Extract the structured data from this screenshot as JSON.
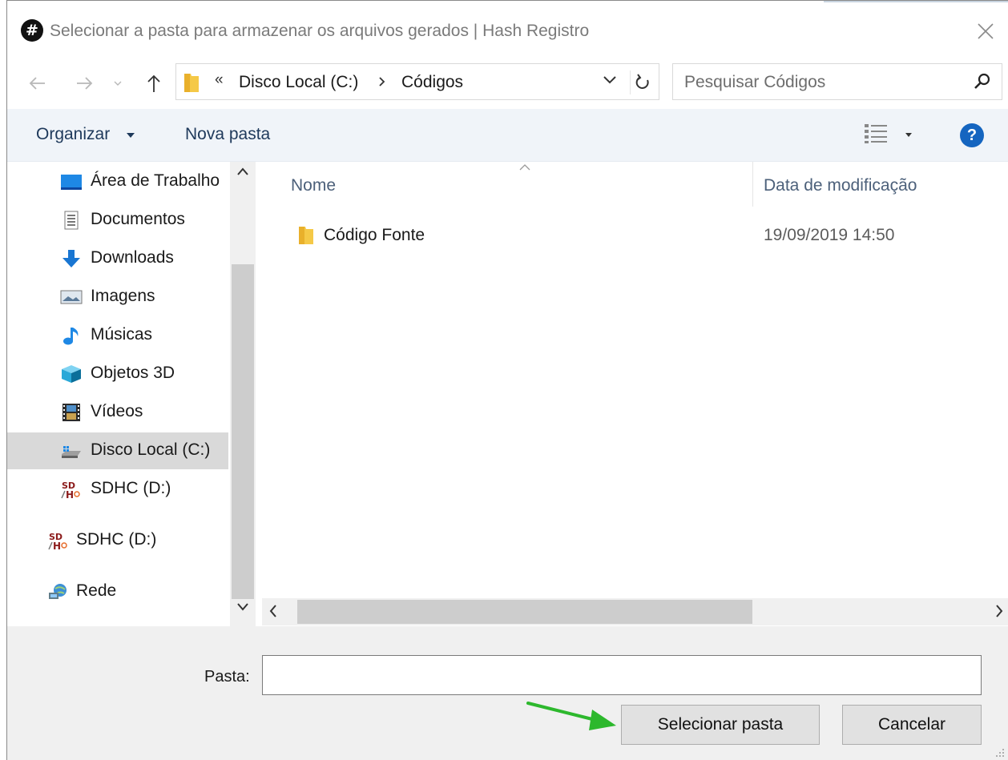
{
  "window": {
    "title": "Selecionar a pasta para armazenar os arquivos gerados | Hash Registro",
    "app_icon_glyph": "#"
  },
  "nav": {
    "address_prefix": "«",
    "breadcrumb": [
      "Disco Local (C:)",
      "Códigos"
    ],
    "search_placeholder": "Pesquisar Códigos"
  },
  "toolbar": {
    "organize_label": "Organizar",
    "new_folder_label": "Nova pasta",
    "help_glyph": "?"
  },
  "sidebar": {
    "items": [
      {
        "label": "Área de Trabalho",
        "icon": "desktop-icon"
      },
      {
        "label": "Documentos",
        "icon": "documents-icon"
      },
      {
        "label": "Downloads",
        "icon": "download-icon"
      },
      {
        "label": "Imagens",
        "icon": "pictures-icon"
      },
      {
        "label": "Músicas",
        "icon": "music-icon"
      },
      {
        "label": "Objetos 3D",
        "icon": "3d-objects-icon"
      },
      {
        "label": "Vídeos",
        "icon": "videos-icon"
      },
      {
        "label": "Disco Local (C:)",
        "icon": "local-disk-icon",
        "selected": true
      },
      {
        "label": "SDHC (D:)",
        "icon": "sd-card-icon"
      },
      {
        "label": "SDHC (D:)",
        "icon": "sd-card-icon"
      },
      {
        "label": "Rede",
        "icon": "network-icon"
      }
    ]
  },
  "filelist": {
    "columns": [
      "Nome",
      "Data de modificação"
    ],
    "rows": [
      {
        "name": "Código Fonte",
        "modified": "19/09/2019 14:50",
        "icon": "folder-icon"
      }
    ]
  },
  "footer": {
    "folder_label": "Pasta:",
    "folder_value": "",
    "select_button": "Selecionar pasta",
    "cancel_button": "Cancelar"
  },
  "colors": {
    "toolbar_bg": "#f0f4f9",
    "link_text": "#1e395b",
    "help_blue": "#1565c0",
    "selected_bg": "#d9d9d9",
    "annotation_arrow": "#2db82d"
  }
}
